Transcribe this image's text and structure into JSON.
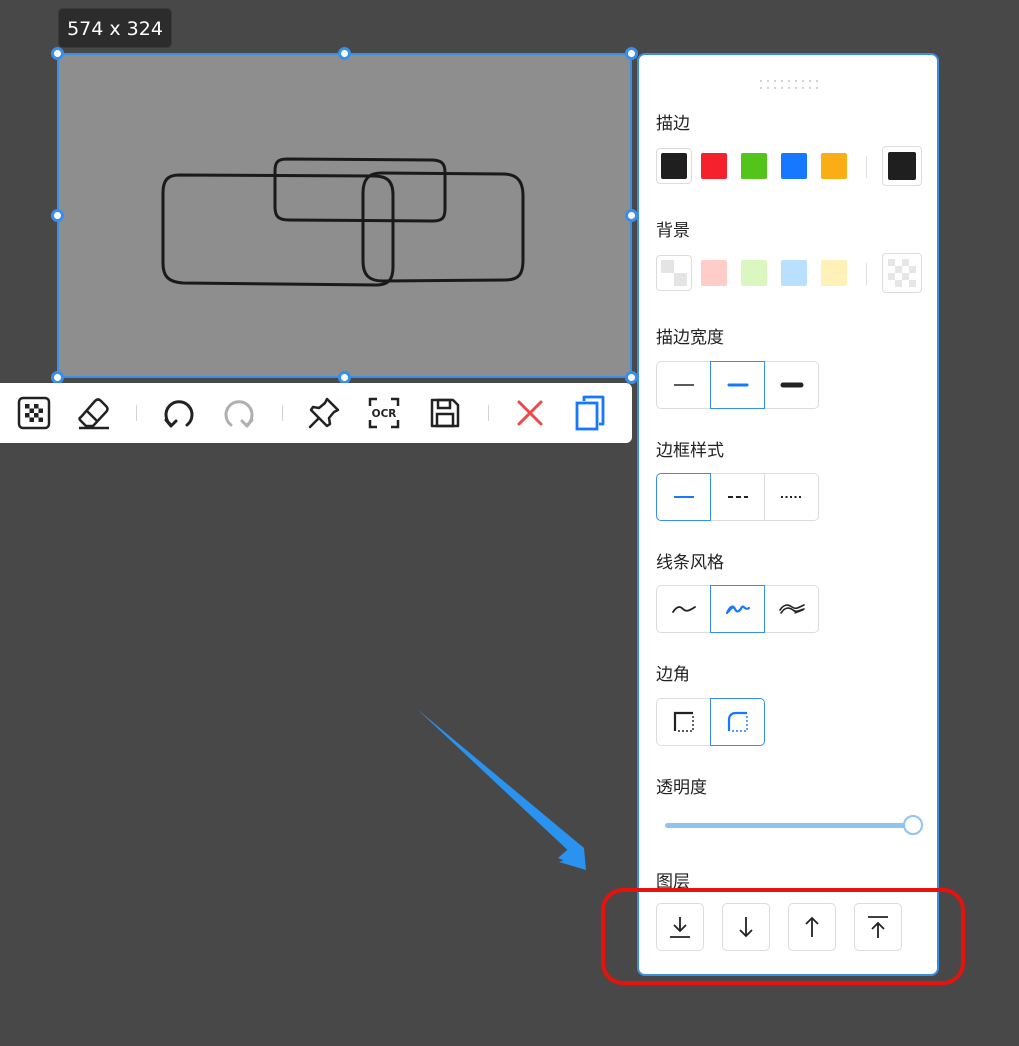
{
  "size_badge": {
    "text": "574 x 324"
  },
  "toolbar": {
    "tools": [
      {
        "name": "mosaic",
        "icon": "mosaic-icon",
        "enabled": true
      },
      {
        "name": "eraser",
        "icon": "eraser-icon",
        "enabled": true
      },
      {
        "name": "undo",
        "icon": "undo-icon",
        "enabled": true
      },
      {
        "name": "redo",
        "icon": "redo-icon",
        "enabled": false
      },
      {
        "name": "pin",
        "icon": "pin-icon",
        "enabled": true
      },
      {
        "name": "ocr",
        "icon": "ocr-icon",
        "label": "OCR",
        "enabled": true
      },
      {
        "name": "save",
        "icon": "save-icon",
        "enabled": true
      },
      {
        "name": "cancel",
        "icon": "close-icon",
        "enabled": true
      },
      {
        "name": "copy",
        "icon": "copy-icon",
        "enabled": true
      }
    ]
  },
  "panel": {
    "stroke": {
      "title": "描边",
      "colors": [
        "#1f1f1f",
        "#f5222d",
        "#52c41a",
        "#1677ff",
        "#faad14"
      ],
      "current": "#1f1f1f"
    },
    "background": {
      "title": "背景",
      "colors": [
        "transparent",
        "#ffccc7",
        "#d9f7be",
        "#bae0ff",
        "#fff1b8"
      ],
      "current": "transparent"
    },
    "stroke_width": {
      "title": "描边宽度",
      "options": [
        "thin",
        "medium",
        "thick"
      ],
      "selected": "medium"
    },
    "border_style": {
      "title": "边框样式",
      "options": [
        "solid",
        "dashed",
        "dotted"
      ],
      "selected": "solid"
    },
    "line_style": {
      "title": "线条风格",
      "options": [
        "architect",
        "artist",
        "cartoonist"
      ],
      "selected": "artist"
    },
    "corner": {
      "title": "边角",
      "options": [
        "sharp",
        "round"
      ],
      "selected": "round"
    },
    "opacity": {
      "title": "透明度",
      "value": 100
    },
    "layer": {
      "title": "图层",
      "buttons": [
        "send-to-back",
        "send-backward",
        "bring-forward",
        "bring-to-front"
      ]
    }
  },
  "colors": {
    "accent": "#3a8ee6",
    "annotation_red": "#e8120c",
    "annotation_arrow": "#2a93ef"
  }
}
